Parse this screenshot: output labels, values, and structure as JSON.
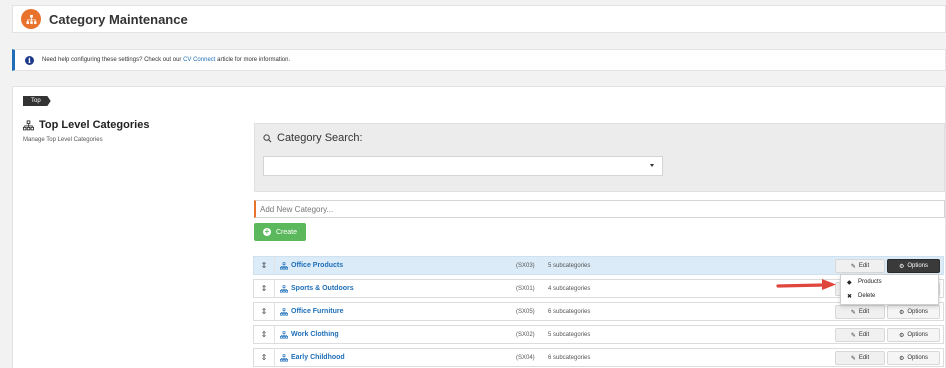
{
  "header": {
    "title": "Category Maintenance"
  },
  "help": {
    "text_before": "Need help configuring these settings? Check out our ",
    "link": "CV Connect",
    "text_after": " article for more information."
  },
  "breadcrumb": "Top",
  "sidebar": {
    "title": "Top Level Categories",
    "subtitle": "Manage Top Level Categories"
  },
  "search": {
    "label": "Category Search:",
    "selected": ""
  },
  "add_category": {
    "placeholder": "Add New Category...",
    "create_label": "Create"
  },
  "buttons": {
    "edit": "Edit",
    "options": "Options"
  },
  "categories": [
    {
      "name": "Office Products",
      "code": "(SX03)",
      "count": "5 subcategories"
    },
    {
      "name": "Sports & Outdoors",
      "code": "(SX01)",
      "count": "4 subcategories"
    },
    {
      "name": "Office Furniture",
      "code": "(SX05)",
      "count": "6 subcategories"
    },
    {
      "name": "Work Clothing",
      "code": "(SX02)",
      "count": "5 subcategories"
    },
    {
      "name": "Early Childhood",
      "code": "(SX04)",
      "count": "6 subcategories"
    }
  ],
  "options_menu": {
    "products": "Products",
    "delete": "Delete"
  },
  "colors": {
    "accent": "#e8722b",
    "link": "#1e6fb8",
    "create": "#5cb85c",
    "arrow": "#e0463c"
  },
  "icons": {
    "logo": "sitemap-icon",
    "category": "sitemap-icon",
    "search": "search-icon",
    "info": "info-icon"
  }
}
